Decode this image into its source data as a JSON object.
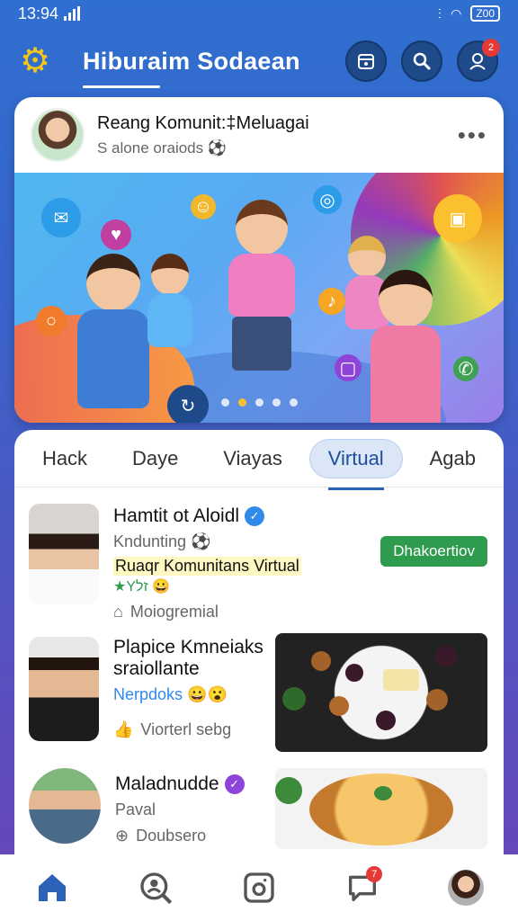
{
  "status_bar": {
    "time": "13:94",
    "battery": "Z00"
  },
  "header": {
    "title": "Hiburaim Sodaean"
  },
  "feature": {
    "title": "Reang Komunit:‡Meluagai",
    "subtitle": "S alone oraiods",
    "more": "•••"
  },
  "tabs": [
    {
      "label": "Hack"
    },
    {
      "label": "Daye"
    },
    {
      "label": "Viayas"
    },
    {
      "label": "Virtual"
    },
    {
      "label": "Agab"
    }
  ],
  "items": [
    {
      "title": "Hamtit ot Aloidl",
      "subtitle": "Kndunting",
      "tag": "Ruaqr Komunitans Virtual",
      "stars": "★Yזל",
      "meta": "Moiogremial",
      "button": "Dhakoertiov",
      "verified_color": "#2f8ae8"
    },
    {
      "title": "Plapice Kmneiaks",
      "title2": "sraiollante",
      "tag": "Nerpdoks",
      "meta": "Viorterl sebg",
      "verified_color": "#2f8ae8"
    },
    {
      "title": "Maladnudde",
      "subtitle": "Paval",
      "meta": "Doubsero",
      "verified_color": "#8e44d8"
    }
  ],
  "colors": {
    "accent": "#2c63b8",
    "green": "#2e9b4f",
    "badge": "#e53935"
  },
  "badges": {
    "profile": "2",
    "messages": "7"
  }
}
